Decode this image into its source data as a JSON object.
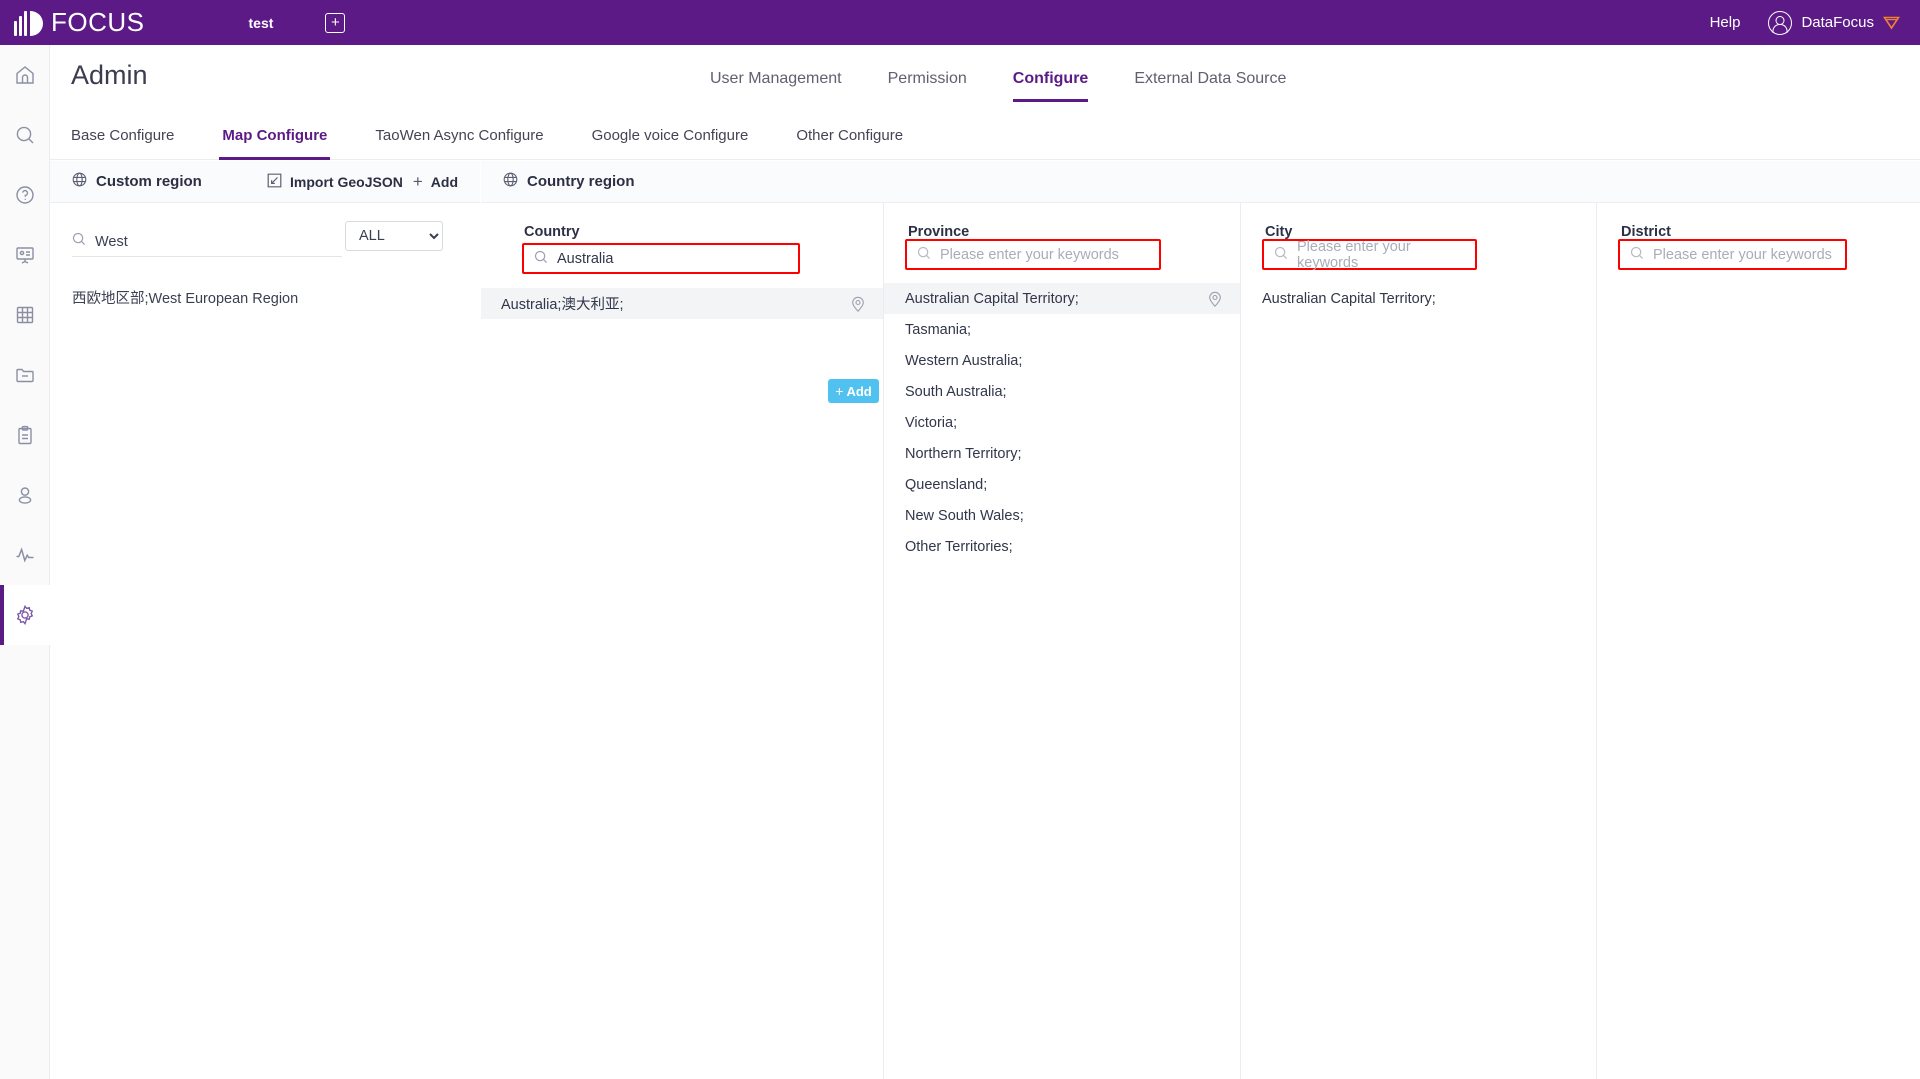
{
  "topbar": {
    "brand": "FOCUS",
    "tab_name": "test",
    "add_tab_icon": "plus-square-icon",
    "help": "Help",
    "user": "DataFocus",
    "vip_icon": "vip-shield-icon",
    "brand_bg": "#5c1a87"
  },
  "rail": {
    "items": [
      {
        "icon": "home-icon",
        "active": false
      },
      {
        "icon": "search-icon",
        "active": false
      },
      {
        "icon": "question-circle-icon",
        "active": false
      },
      {
        "icon": "presentation-icon",
        "active": false
      },
      {
        "icon": "table-grid-icon",
        "active": false
      },
      {
        "icon": "folder-minus-icon",
        "active": false
      },
      {
        "icon": "clipboard-icon",
        "active": false
      },
      {
        "icon": "user-icon",
        "active": false
      },
      {
        "icon": "pulse-icon",
        "active": false
      },
      {
        "icon": "gear-icon",
        "active": true
      }
    ]
  },
  "header": {
    "title": "Admin",
    "nav": [
      {
        "label": "User Management",
        "active": false
      },
      {
        "label": "Permission",
        "active": false
      },
      {
        "label": "Configure",
        "active": true
      },
      {
        "label": "External Data Source",
        "active": false
      }
    ]
  },
  "subtabs": [
    {
      "label": "Base Configure",
      "active": false
    },
    {
      "label": "Map Configure",
      "active": true
    },
    {
      "label": "TaoWen Async Configure",
      "active": false
    },
    {
      "label": "Google voice Configure",
      "active": false
    },
    {
      "label": "Other Configure",
      "active": false
    }
  ],
  "custom_region": {
    "icon": "globe-icon",
    "title": "Custom region",
    "import_icon": "import-geojson-icon",
    "import_label": "Import GeoJSON",
    "add_label": "Add",
    "search": {
      "icon": "search-icon",
      "value": "West",
      "placeholder": ""
    },
    "filter": {
      "selected": "ALL",
      "options": [
        "ALL"
      ]
    },
    "rows": [
      {
        "label": "西欧地区部;West European Region"
      }
    ]
  },
  "country_region": {
    "icon": "globe-icon",
    "title": "Country region",
    "add_button": {
      "label": "Add",
      "icon": "plus-icon",
      "color": "#51c2f0"
    },
    "highlight_color": "#ff0000",
    "columns": [
      {
        "key": "country",
        "label": "Country",
        "search_value": "Australia",
        "search_placeholder": "",
        "highlighted": true,
        "options": [
          {
            "label": "Australia;澳大利亚;",
            "selected": true,
            "pin": "location-pin-icon"
          }
        ]
      },
      {
        "key": "province",
        "label": "Province",
        "search_value": "",
        "search_placeholder": "Please enter your keywords",
        "highlighted": true,
        "options": [
          {
            "label": "Australian Capital Territory;",
            "selected": true,
            "pin": "location-pin-icon"
          },
          {
            "label": "Tasmania;",
            "selected": false
          },
          {
            "label": "Western Australia;",
            "selected": false
          },
          {
            "label": "South Australia;",
            "selected": false
          },
          {
            "label": "Victoria;",
            "selected": false
          },
          {
            "label": "Northern Territory;",
            "selected": false
          },
          {
            "label": "Queensland;",
            "selected": false
          },
          {
            "label": "New South Wales;",
            "selected": false
          },
          {
            "label": "Other Territories;",
            "selected": false
          }
        ]
      },
      {
        "key": "city",
        "label": "City",
        "search_value": "",
        "search_placeholder": "Please enter your keywords",
        "highlighted": true,
        "options": [
          {
            "label": "Australian Capital Territory;",
            "selected": false
          }
        ]
      },
      {
        "key": "district",
        "label": "District",
        "search_value": "",
        "search_placeholder": "Please enter your keywords",
        "highlighted": true,
        "options": []
      }
    ]
  }
}
